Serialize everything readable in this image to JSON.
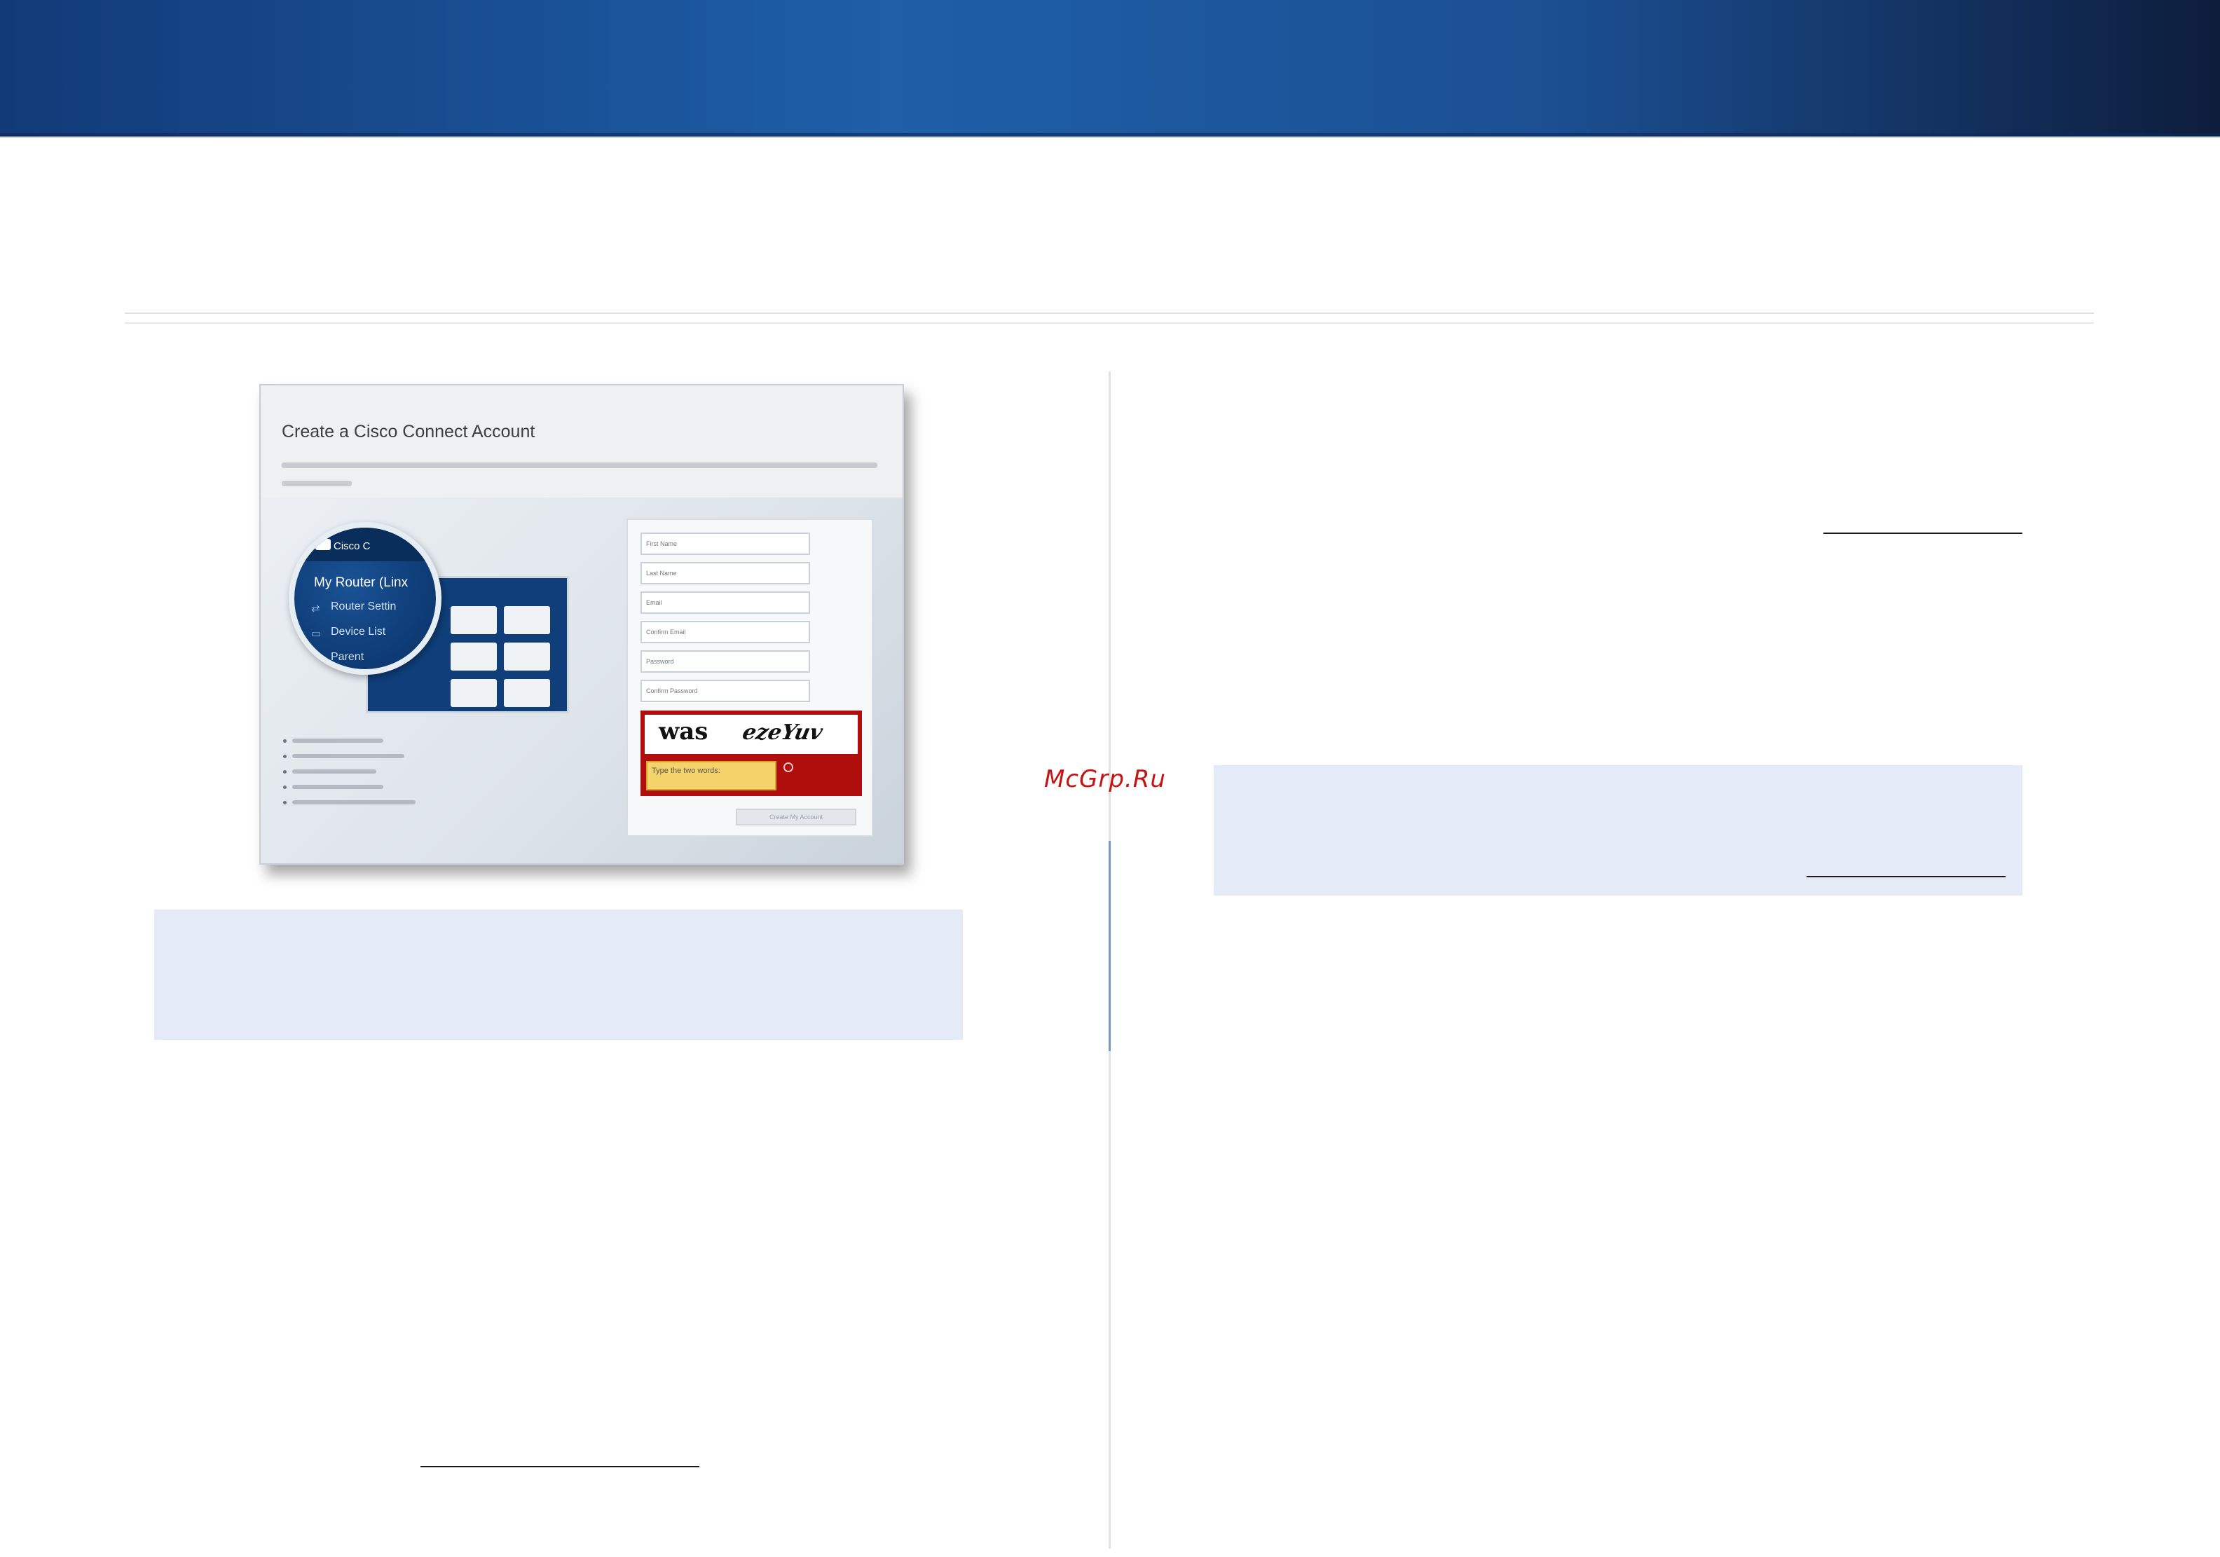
{
  "header": {
    "band_color": "#1e5fa8"
  },
  "figure": {
    "title": "Create a Cisco Connect Account",
    "magnifier": {
      "logo": "Cisco C",
      "title": "My Router (Linx",
      "items": [
        {
          "label": "Router Settin",
          "icon": "router-icon"
        },
        {
          "label": "Device List",
          "icon": "device-icon"
        },
        {
          "label": "Parent",
          "icon": "parental-icon"
        }
      ]
    },
    "form_fields": [
      "First Name",
      "Last Name",
      "Email",
      "Confirm Email",
      "Password",
      "Confirm Password"
    ],
    "captcha": {
      "word1": "was",
      "word2": "ezeYuv",
      "input_placeholder": "Type the two words:"
    },
    "create_button": "Create My Account"
  },
  "watermark": "McGrp.Ru"
}
